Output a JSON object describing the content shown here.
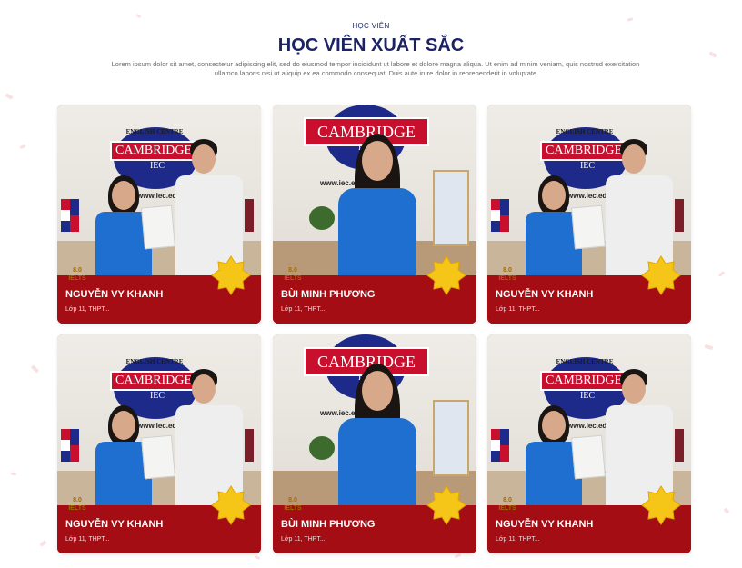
{
  "header": {
    "eyebrow": "HỌC VIÊN",
    "title": "HỌC VIÊN XUẤT SẮC",
    "description": "Lorem ipsum dolor sit amet, consectetur adipiscing elit, sed do eiusmod tempor incididunt ut labore et dolore magna aliqua. Ut enim ad minim veniam, quis nostrud exercitation ullamco laboris nisi ut aliquip ex ea commodo consequat. Duis aute irure dolor in reprehenderit in voluptate"
  },
  "cards": [
    {
      "name": "NGUYỄN VY KHANH",
      "class": "Lớp 11, THPT...",
      "score": "8.0",
      "test": "IELTS",
      "photo": "award-photo"
    },
    {
      "name": "BÙI MINH PHƯƠNG",
      "class": "Lớp 11, THPT...",
      "score": "8.0",
      "test": "IELTS",
      "photo": "portrait-photo"
    },
    {
      "name": "NGUYỄN VY KHANH",
      "class": "Lớp 11, THPT...",
      "score": "8.0",
      "test": "IELTS",
      "photo": "award-photo"
    },
    {
      "name": "NGUYỄN VY KHANH",
      "class": "Lớp 11, THPT...",
      "score": "8.0",
      "test": "IELTS",
      "photo": "award-photo"
    },
    {
      "name": "BÙI MINH PHƯƠNG",
      "class": "Lớp 11, THPT...",
      "score": "8.0",
      "test": "IELTS",
      "photo": "portrait-photo"
    },
    {
      "name": "NGUYỄN VY KHANH",
      "class": "Lớp 11, THPT...",
      "score": "8.0",
      "test": "IELTS",
      "photo": "award-photo"
    }
  ],
  "photo_text": {
    "centre": "ENGLISH CENTRE",
    "brand": "CAMBRIDGE",
    "iec": "IEC",
    "url": "www.iec.edu"
  },
  "colors": {
    "card_red": "#a50d14",
    "title_navy": "#1c2364",
    "badge_gold": "#f5c518"
  }
}
